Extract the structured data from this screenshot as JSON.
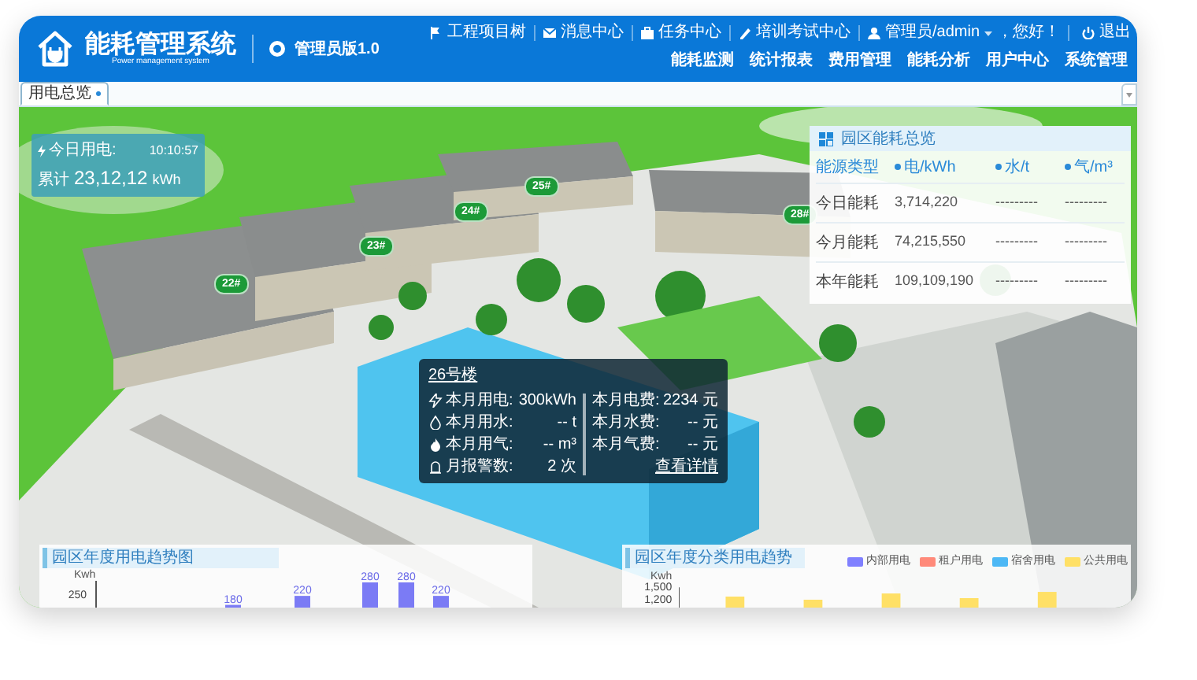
{
  "header": {
    "title": "能耗管理系统",
    "subtitle": "Power management system",
    "version": "管理员版1.0"
  },
  "top_links": [
    {
      "kind": "tree",
      "label": "工程项目树"
    },
    {
      "kind": "mail",
      "label": "消息中心"
    },
    {
      "kind": "task",
      "label": "任务中心"
    },
    {
      "kind": "exam",
      "label": "培训考试中心"
    },
    {
      "kind": "user",
      "label": "管理员/admin"
    }
  ],
  "greeting": "，您好！",
  "logout": "退出",
  "nav": [
    "能耗监测",
    "统计报表",
    "费用管理",
    "能耗分析",
    "用户中心",
    "系统管理"
  ],
  "tabs": [
    {
      "label": "用电总览",
      "selected": true
    }
  ],
  "today": {
    "label": "今日用电:",
    "time": "10:10:57",
    "total_label": "累计",
    "total": "23,12,12",
    "unit": "kWh"
  },
  "building_labels": [
    "25#",
    "24#",
    "28#",
    "23#",
    "22#"
  ],
  "overview": {
    "title": "园区能耗总览",
    "columns": [
      {
        "label": "能源类型",
        "dot": false
      },
      {
        "label": "电/kWh",
        "dot": true
      },
      {
        "label": "水/t",
        "dot": true
      },
      {
        "label": "气/m³",
        "dot": true
      }
    ],
    "rows": [
      {
        "label": "今日能耗",
        "values": [
          "3,714,220",
          "---------",
          "---------"
        ]
      },
      {
        "label": "今月能耗",
        "values": [
          "74,215,550",
          "---------",
          "---------"
        ]
      },
      {
        "label": "本年能耗",
        "values": [
          "109,109,190",
          "---------",
          "---------"
        ]
      }
    ]
  },
  "popup": {
    "title": "26号楼",
    "left": [
      {
        "kind": "electricity",
        "label": "本月用电:",
        "value": "300kWh"
      },
      {
        "kind": "water",
        "label": "本月用水:",
        "value": "-- t"
      },
      {
        "kind": "gas",
        "label": "本月用气:",
        "value": "-- m³"
      },
      {
        "kind": "alarm",
        "label": "月报警数:",
        "value": "2 次"
      }
    ],
    "right": [
      {
        "label": "本月电费:",
        "value": "2234 元"
      },
      {
        "label": "本月水费:",
        "value": "-- 元"
      },
      {
        "label": "本月气费:",
        "value": "-- 元"
      }
    ],
    "link": "查看详情"
  },
  "trend_chart": {
    "title": "园区年度用电趋势图",
    "unit": "Kwh",
    "ticks": [
      "250"
    ],
    "bar_labels": [
      "180",
      "220",
      "280",
      "280",
      "220"
    ]
  },
  "category_chart": {
    "title": "园区年度分类用电趋势",
    "unit": "Kwh",
    "ticks": [
      "1,500",
      "1,200"
    ],
    "legend": [
      {
        "label": "内部用电",
        "color": "#8080ff"
      },
      {
        "label": "租户用电",
        "color": "#ff8a7a"
      },
      {
        "label": "宿舍用电",
        "color": "#4db8f5"
      },
      {
        "label": "公共用电",
        "color": "#ffe066"
      }
    ]
  }
}
